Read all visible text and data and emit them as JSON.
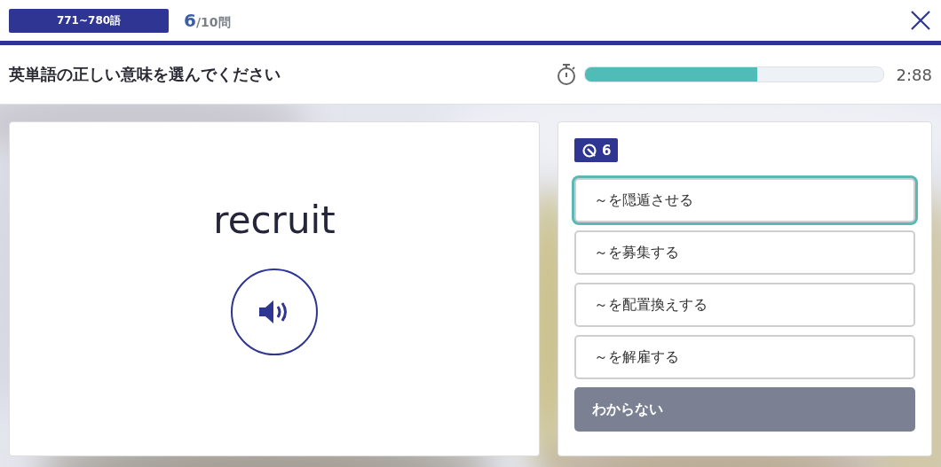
{
  "header": {
    "range_label": "771~780語",
    "progress": {
      "current": "6",
      "total": "/10問"
    }
  },
  "instruction": "英単語の正しい意味を選んでください",
  "timer": {
    "level": 0.58,
    "reading": "2:88"
  },
  "word_card": {
    "word": "recruit"
  },
  "answer_panel": {
    "badge": "6",
    "options": [
      {
        "label": "～を隠遁させる",
        "selected": true
      },
      {
        "label": "～を募集する",
        "selected": false
      },
      {
        "label": "～を配置換えする",
        "selected": false
      },
      {
        "label": "～を解雇する",
        "selected": false
      }
    ],
    "skip_button": "わからない"
  }
}
